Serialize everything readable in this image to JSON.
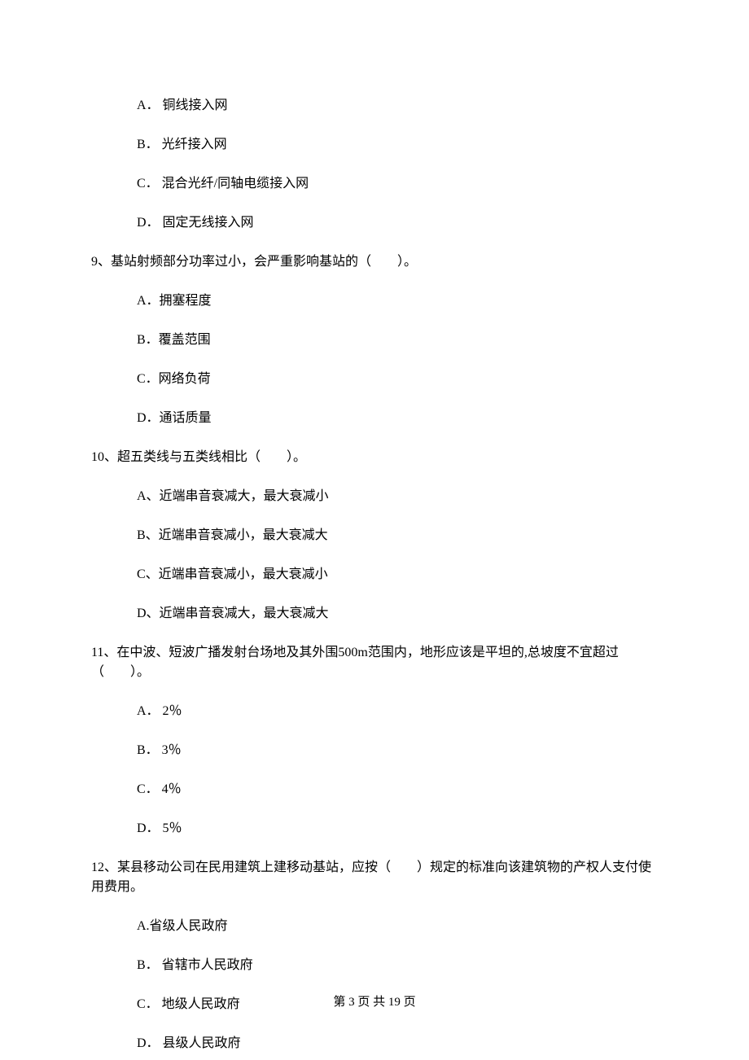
{
  "q8": {
    "optA": "A． 铜线接入网",
    "optB": "B． 光纤接入网",
    "optC": "C． 混合光纤/同轴电缆接入网",
    "optD": "D． 固定无线接入网"
  },
  "q9": {
    "text": "9、基站射频部分功率过小，会严重影响基站的（　　）。",
    "optA": "A．拥塞程度",
    "optB": "B．覆盖范围",
    "optC": "C．网络负荷",
    "optD": "D．通话质量"
  },
  "q10": {
    "text": "10、超五类线与五类线相比（　　）。",
    "optA": "A、近端串音衰减大，最大衰减小",
    "optB": "B、近端串音衰减小，最大衰减大",
    "optC": "C、近端串音衰减小，最大衰减小",
    "optD": "D、近端串音衰减大，最大衰减大"
  },
  "q11": {
    "text": "11、在中波、短波广播发射台场地及其外围500m范围内，地形应该是平坦的,总坡度不宜超过（　　）。",
    "optA": "A．  2％",
    "optB": "B．  3％",
    "optC": "C．  4％",
    "optD": "D．  5％"
  },
  "q12": {
    "text": "12、某县移动公司在民用建筑上建移动基站，应按（　　）规定的标准向该建筑物的产权人支付使用费用。",
    "optA": "A.省级人民政府",
    "optB": "B． 省辖市人民政府",
    "optC": "C． 地级人民政府",
    "optD": "D． 县级人民政府"
  },
  "footer": "第 3 页 共 19 页"
}
